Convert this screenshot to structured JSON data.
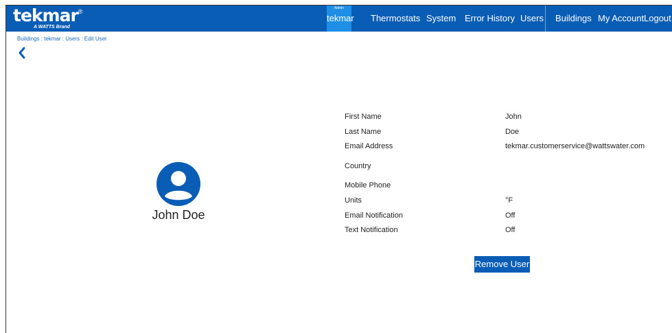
{
  "header": {
    "logo_text": "tekmar",
    "logo_sub": "A WATTS Brand",
    "nav": [
      {
        "label": "tekmar",
        "tag": "Admin"
      },
      {
        "label": "Thermostats"
      },
      {
        "label": "System"
      },
      {
        "label": "Error History"
      },
      {
        "label": "Users"
      },
      {
        "label": "Buildings"
      },
      {
        "label": "My Account"
      },
      {
        "label": "Logout"
      }
    ]
  },
  "breadcrumb": "Buildings : tekmar : Users : Edit User",
  "profile": {
    "name": "John Doe"
  },
  "fields": [
    {
      "label": "First Name",
      "value": "John"
    },
    {
      "label": "Last Name",
      "value": "Doe"
    },
    {
      "label": "Email Address",
      "value": "tekmar.customerservice@wattswater.com"
    },
    {
      "label": "Country",
      "value": ""
    },
    {
      "label": "Mobile Phone",
      "value": ""
    },
    {
      "label": "Units",
      "value": "°F"
    },
    {
      "label": "Email Notification",
      "value": "Off"
    },
    {
      "label": "Text Notification",
      "value": "Off"
    }
  ],
  "actions": {
    "remove_label": "Remove User"
  },
  "colors": {
    "header": "#0a5db5",
    "active_tab": "#1e8ee6",
    "link": "#1a6ab8"
  }
}
